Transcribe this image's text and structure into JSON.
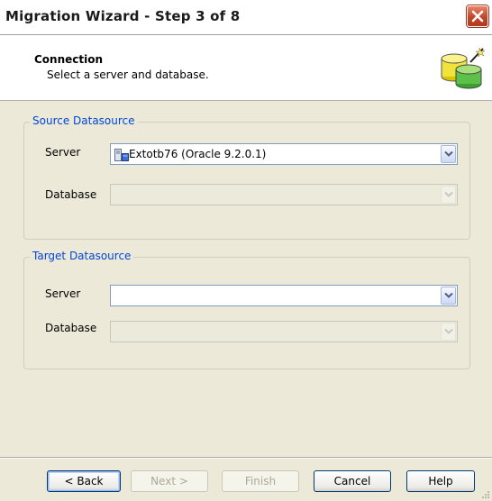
{
  "window": {
    "title": "Migration Wizard - Step 3 of 8"
  },
  "header": {
    "title": "Connection",
    "subtitle": "Select a server and database."
  },
  "source": {
    "legend": "Source Datasource",
    "server_label": "Server",
    "server_value": "Extotb76 (Oracle 9.2.0.1)",
    "database_label": "Database",
    "database_value": ""
  },
  "target": {
    "legend": "Target Datasource",
    "server_label": "Server",
    "server_value": "",
    "database_label": "Database",
    "database_value": ""
  },
  "buttons": {
    "back": "< Back",
    "next": "Next >",
    "finish": "Finish",
    "cancel": "Cancel",
    "help": "Help"
  },
  "icons": {
    "close": "close-icon",
    "header": "database-wizard-icon",
    "server": "server-icon",
    "dropdown": "chevron-down-icon"
  },
  "colors": {
    "accent": "#0046d5",
    "panel": "#ece9d8",
    "close": "#c4452a"
  }
}
